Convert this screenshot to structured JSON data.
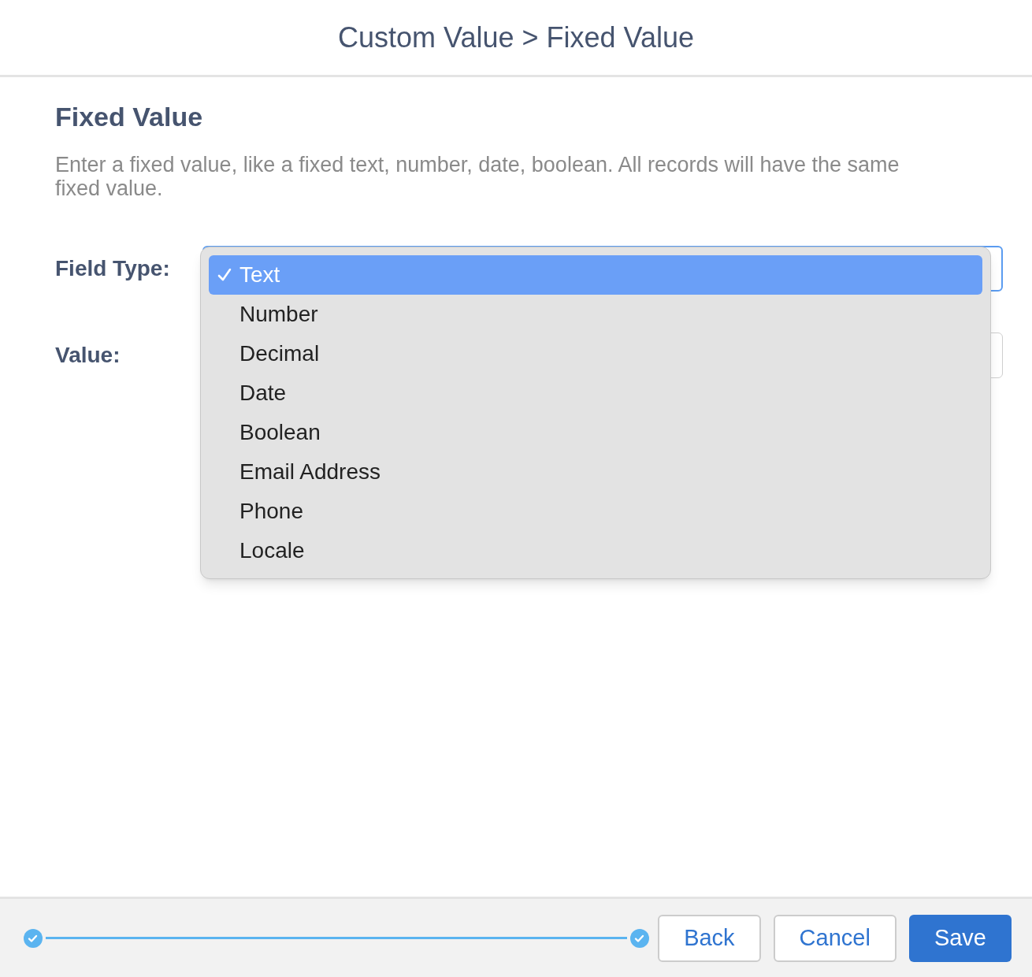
{
  "header": {
    "title": "Custom Value > Fixed Value"
  },
  "section": {
    "title": "Fixed Value",
    "description": "Enter a fixed value, like a fixed text, number, date, boolean. All records will have the same fixed value."
  },
  "fields": [
    {
      "label": "Field Type:",
      "kind": "select"
    },
    {
      "label": "Value:",
      "kind": "input"
    }
  ],
  "dropdown": {
    "options": [
      {
        "label": "Text",
        "selected": true
      },
      {
        "label": "Number",
        "selected": false
      },
      {
        "label": "Decimal",
        "selected": false
      },
      {
        "label": "Date",
        "selected": false
      },
      {
        "label": "Boolean",
        "selected": false
      },
      {
        "label": "Email Address",
        "selected": false
      },
      {
        "label": "Phone",
        "selected": false
      },
      {
        "label": "Locale",
        "selected": false
      }
    ]
  },
  "footer": {
    "steps": [
      {
        "done": true
      },
      {
        "done": true
      }
    ],
    "buttons": [
      {
        "label": "Back",
        "kind": "secondary"
      },
      {
        "label": "Cancel",
        "kind": "secondary"
      },
      {
        "label": "Save",
        "kind": "primary"
      }
    ]
  }
}
